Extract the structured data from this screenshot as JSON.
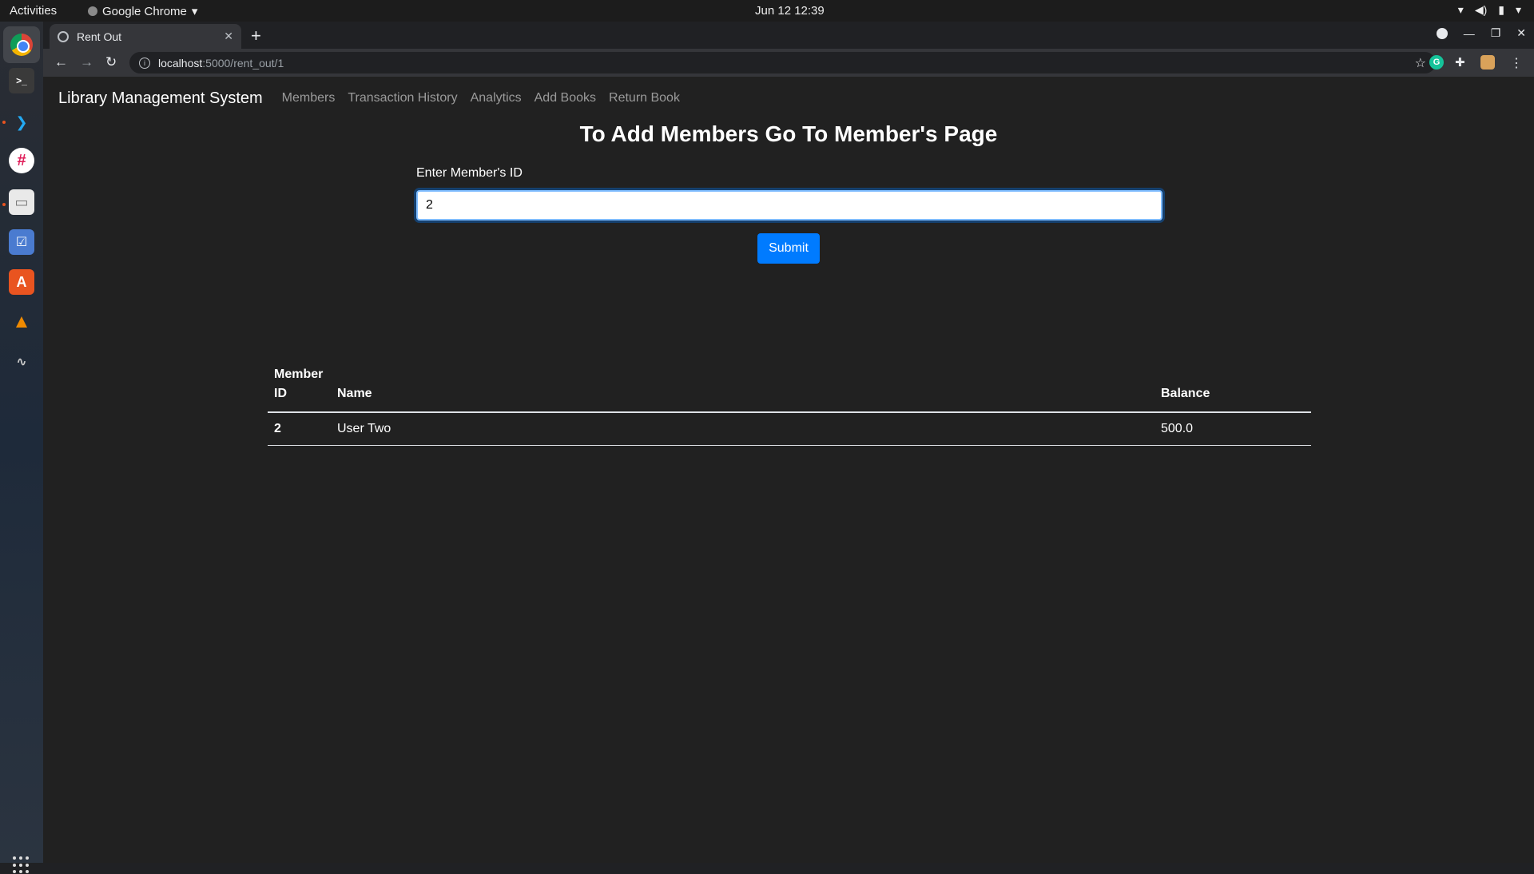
{
  "system": {
    "activities": "Activities",
    "app_name": "Google Chrome",
    "clock": "Jun 12  12:39"
  },
  "browser": {
    "tab_title": "Rent Out",
    "url_host": "localhost",
    "url_path": ":5000/rent_out/1"
  },
  "navbar": {
    "brand": "Library Management System",
    "links": [
      "Members",
      "Transaction History",
      "Analytics",
      "Add Books",
      "Return Book"
    ]
  },
  "page": {
    "heading": "To Add Members Go To Member's Page",
    "form": {
      "label": "Enter Member's ID",
      "value": "2",
      "submit": "Submit"
    }
  },
  "table": {
    "headers": [
      "Member ID",
      "Name",
      "Balance"
    ],
    "rows": [
      [
        "2",
        "User Two",
        "500.0"
      ]
    ]
  },
  "colors": {
    "page_bg": "#212121",
    "primary": "#007bff"
  }
}
